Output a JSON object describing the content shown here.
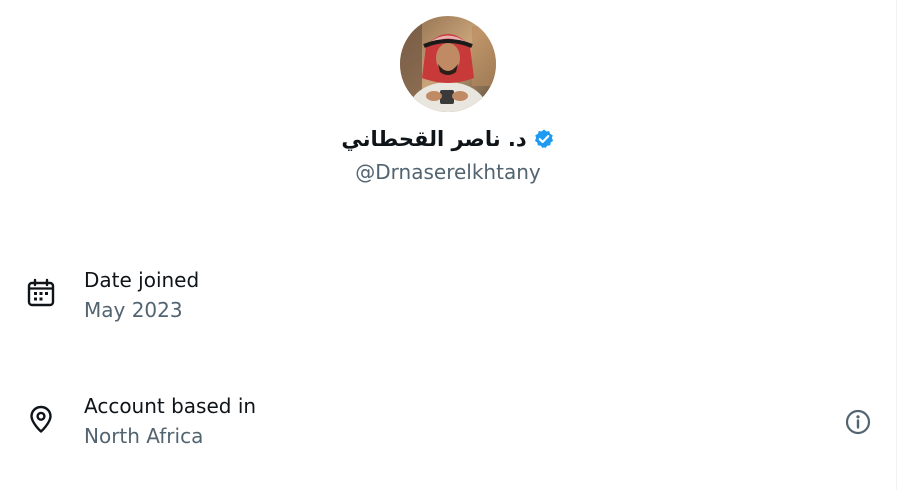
{
  "profile": {
    "display_name": "د. ناصر القحطاني",
    "handle": "@Drnaserelkhtany",
    "verified": true,
    "verified_color": "#1d9bf0"
  },
  "details": [
    {
      "icon": "calendar-icon",
      "label": "Date joined",
      "value": "May 2023"
    },
    {
      "icon": "location-pin-icon",
      "label": "Account based in",
      "value": "North Africa",
      "action_icon": "info-icon"
    }
  ],
  "colors": {
    "primary_text": "#0f1419",
    "secondary_text": "#536471",
    "background": "#ffffff"
  }
}
